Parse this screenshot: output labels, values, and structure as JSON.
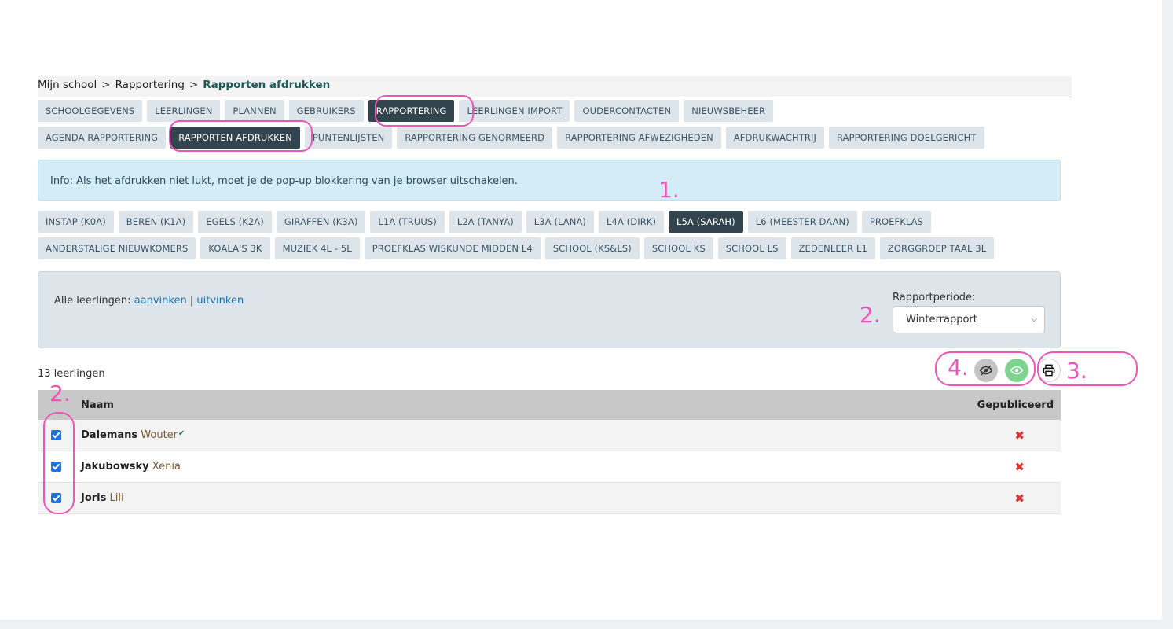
{
  "breadcrumb": {
    "items": [
      "Mijn school",
      "Rapportering"
    ],
    "current": "Rapporten afdrukken",
    "separator": ">"
  },
  "main_tabs": [
    {
      "label": "SCHOOLGEGEVENS",
      "active": false
    },
    {
      "label": "LEERLINGEN",
      "active": false
    },
    {
      "label": "PLANNEN",
      "active": false
    },
    {
      "label": "GEBRUIKERS",
      "active": false
    },
    {
      "label": "RAPPORTERING",
      "active": true
    },
    {
      "label": "LEERLINGEN IMPORT",
      "active": false
    },
    {
      "label": "OUDERCONTACTEN",
      "active": false
    },
    {
      "label": "NIEUWSBEHEER",
      "active": false
    }
  ],
  "sub_tabs": [
    {
      "label": "AGENDA RAPPORTERING",
      "active": false
    },
    {
      "label": "RAPPORTEN AFDRUKKEN",
      "active": true
    },
    {
      "label": "PUNTENLIJSTEN",
      "active": false
    },
    {
      "label": "RAPPORTERING GENORMEERD",
      "active": false
    },
    {
      "label": "RAPPORTERING AFWEZIGHEDEN",
      "active": false
    },
    {
      "label": "AFDRUKWACHTRIJ",
      "active": false
    },
    {
      "label": "RAPPORTERING DOELGERICHT",
      "active": false
    }
  ],
  "info_text": "Info: Als het afdrukken niet lukt, moet je de pop-up blokkering van je browser uitschakelen.",
  "class_tabs_row1": [
    {
      "label": "INSTAP (K0A)",
      "active": false
    },
    {
      "label": "BEREN (K1A)",
      "active": false
    },
    {
      "label": "EGELS (K2A)",
      "active": false
    },
    {
      "label": "GIRAFFEN (K3A)",
      "active": false
    },
    {
      "label": "L1A (TRUUS)",
      "active": false
    },
    {
      "label": "L2A (TANYA)",
      "active": false
    },
    {
      "label": "L3A (LANA)",
      "active": false
    },
    {
      "label": "L4A (DIRK)",
      "active": false
    },
    {
      "label": "L5A (SARAH)",
      "active": true
    },
    {
      "label": "L6 (MEESTER DAAN)",
      "active": false
    },
    {
      "label": "PROEFKLAS",
      "active": false
    }
  ],
  "class_tabs_row2": [
    {
      "label": "ANDERSTALIGE NIEUWKOMERS",
      "active": false
    },
    {
      "label": "KOALA'S 3K",
      "active": false
    },
    {
      "label": "MUZIEK 4L - 5L",
      "active": false
    },
    {
      "label": "PROEFKLAS WISKUNDE MIDDEN L4",
      "active": false
    },
    {
      "label": "SCHOOL (KS&LS)",
      "active": false
    },
    {
      "label": "SCHOOL KS",
      "active": false
    },
    {
      "label": "SCHOOL LS",
      "active": false
    },
    {
      "label": "ZEDENLEER L1",
      "active": false
    },
    {
      "label": "ZORGGROEP TAAL 3L",
      "active": false
    }
  ],
  "filter": {
    "all_students_label": "Alle leerlingen:",
    "check_all": "aanvinken",
    "divider": "|",
    "uncheck_all": "uitvinken",
    "period_label": "Rapportperiode:",
    "period_value": "Winterrapport"
  },
  "student_count": "13 leerlingen",
  "table": {
    "col_name": "Naam",
    "col_published": "Gepubliceerd",
    "rows": [
      {
        "last": "Dalemans",
        "first": "Wouter",
        "verified": true,
        "checked": true,
        "published_mark": "✖"
      },
      {
        "last": "Jakubowsky",
        "first": "Xenia",
        "verified": false,
        "checked": true,
        "published_mark": "✖"
      },
      {
        "last": "Joris",
        "first": "Lili",
        "verified": false,
        "checked": true,
        "published_mark": "✖"
      }
    ]
  },
  "actions": {
    "hide_icon": "eye-slash-icon",
    "show_icon": "eye-icon",
    "print_icon": "printer-icon",
    "hide_color": "#c4c4c4",
    "show_color": "#7dd38f"
  },
  "annotations": {
    "n1": "1.",
    "n2a": "2.",
    "n2b": "2.",
    "n3": "3.",
    "n4": "4.",
    "color": "#ee55b8"
  }
}
